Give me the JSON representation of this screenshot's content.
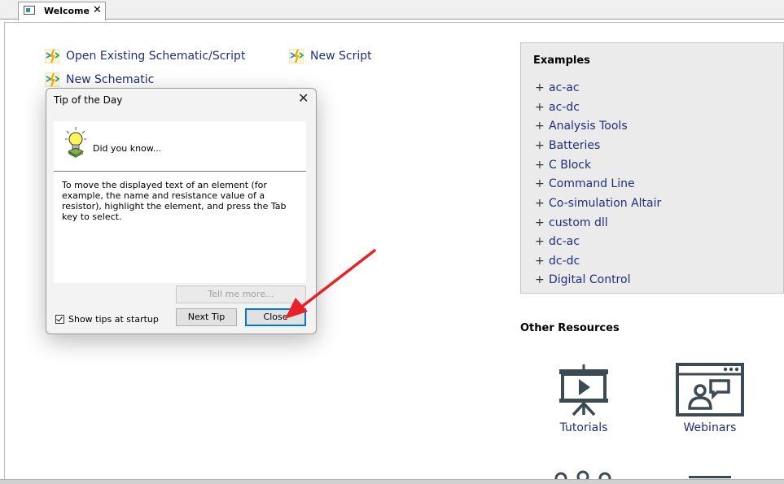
{
  "tab": {
    "label": "Welcome",
    "close": "✕"
  },
  "links": {
    "open_existing": "Open Existing Schematic/Script",
    "new_script": "New Script",
    "new_schematic": "New Schematic"
  },
  "examples": {
    "title": "Examples",
    "plus": "+",
    "items": [
      "ac-ac",
      "ac-dc",
      "Analysis Tools",
      "Batteries",
      "C Block",
      "Command Line",
      "Co-simulation Altair",
      "custom dll",
      "dc-ac",
      "dc-dc",
      "Digital Control"
    ]
  },
  "resources": {
    "title": "Other Resources",
    "tutorials": "Tutorials",
    "webinars": "Webinars"
  },
  "dialog": {
    "title": "Tip of the Day",
    "close": "✕",
    "did_you_know": "Did you know...",
    "tip": "To move the displayed text of an element (for example, the name and resistance value of a resistor), highlight the element, and press the Tab key to select.",
    "tell_me_more": "Tell me more...",
    "next_tip": "Next Tip",
    "close_button": "Close",
    "show_tips": "Show tips at startup",
    "show_tips_checked": true
  },
  "colors": {
    "link": "#1f2f7a",
    "panel": "#ebebeb",
    "annotation_arrow": "#e8202a",
    "focus": "#0078d7"
  }
}
